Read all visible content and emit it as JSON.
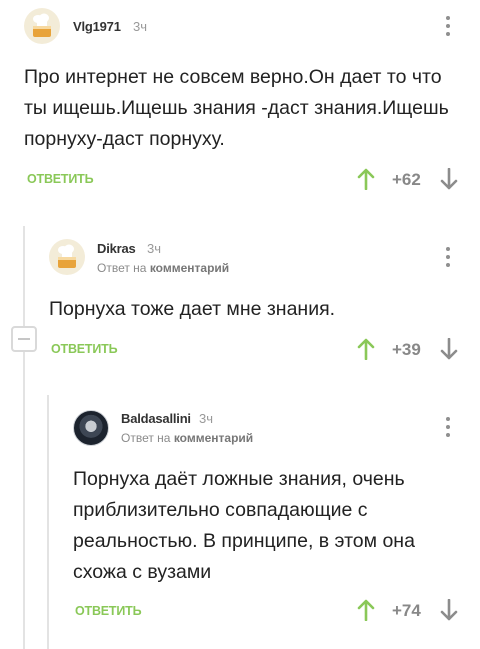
{
  "comments": [
    {
      "username": "Vlg1971",
      "time": "3ч",
      "text": "Про интернет не совсем верно.Он дает то что ты ищешь.Ищешь знания -даст знания.Ищешь порнуху-даст порнуху.",
      "reply_label": "ОТВЕТИТЬ",
      "score": "+62"
    },
    {
      "username": "Dikras",
      "time": "3ч",
      "reply_prefix": "Ответ на",
      "reply_target": "комментарий",
      "text": "Порнуха тоже дает мне знания.",
      "reply_label": "ОТВЕТИТЬ",
      "score": "+39"
    },
    {
      "username": "Baldasallini",
      "time": "3ч",
      "reply_prefix": "Ответ на",
      "reply_target": "комментарий",
      "text": "Порнуха даёт ложные знания, очень приблизительно совпадающие с реальностью. В принципе, в этом она схожа с вузами",
      "reply_label": "ОТВЕТИТЬ",
      "score": "+74"
    }
  ],
  "colors": {
    "accent_green": "#8ac858",
    "text": "#222222",
    "muted": "#999999"
  },
  "icons": [
    "cake-avatar-icon",
    "emblem-avatar-icon",
    "more-vertical-icon",
    "upvote-arrow-icon",
    "downvote-arrow-icon",
    "collapse-minus-icon"
  ]
}
